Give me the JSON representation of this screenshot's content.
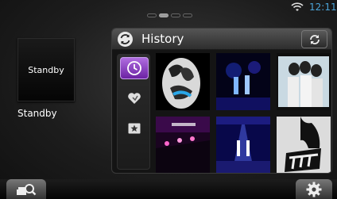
{
  "status_bar": {
    "time": "12:11",
    "wifi_icon": "wifi-icon",
    "page_indicator": {
      "count": 4,
      "active_index": 1
    },
    "accent_color": "#4aa3d8"
  },
  "source": {
    "tile_label": "Standby",
    "label": "Standby"
  },
  "history": {
    "title": "History",
    "title_icon": "history-icon",
    "refresh_icon": "refresh-icon",
    "tabs": [
      {
        "icon": "clock-icon",
        "selected": true
      },
      {
        "icon": "heart-icon",
        "selected": false
      },
      {
        "icon": "star-icon",
        "selected": false
      }
    ],
    "tab_accent": "#8e3fc8",
    "items": [
      {
        "icon": "album-art-1"
      },
      {
        "icon": "album-art-2"
      },
      {
        "icon": "album-art-3"
      },
      {
        "icon": "album-art-4"
      },
      {
        "icon": "album-art-5"
      },
      {
        "icon": "album-art-6"
      }
    ]
  },
  "bottom_bar": {
    "search_icon": "search-icon",
    "settings_icon": "gear-icon"
  }
}
